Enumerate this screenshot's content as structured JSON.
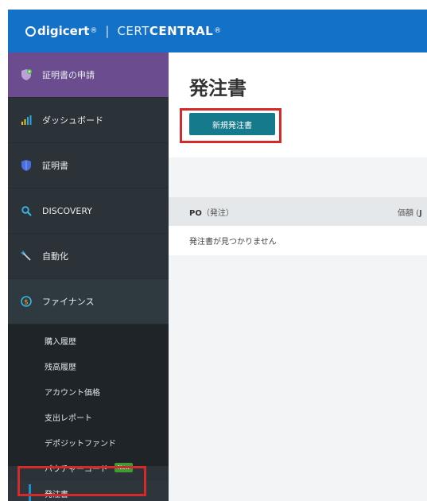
{
  "header": {
    "logo_brand": "digicert",
    "logo_reg": "®",
    "logo_sep": "|",
    "logo_product_1": "CERT",
    "logo_product_2": "CENTRAL",
    "logo_product_reg": "®"
  },
  "sidebar": {
    "items": [
      {
        "label": "証明書の申請",
        "icon": "shield-plus-icon"
      },
      {
        "label": "ダッシュボード",
        "icon": "bar-chart-icon"
      },
      {
        "label": "証明書",
        "icon": "shield-icon"
      },
      {
        "label": "DISCOVERY",
        "icon": "search-icon"
      },
      {
        "label": "自動化",
        "icon": "wand-icon"
      },
      {
        "label": "ファイナンス",
        "icon": "dollar-circle-icon"
      }
    ],
    "finance_subitems": [
      {
        "label": "購入履歴"
      },
      {
        "label": "残高履歴"
      },
      {
        "label": "アカウント価格"
      },
      {
        "label": "支出レポート"
      },
      {
        "label": "デポジットファンド"
      },
      {
        "label": "バウチャーコード",
        "badge": "New"
      },
      {
        "label": "発注書"
      }
    ]
  },
  "main": {
    "title": "発注書",
    "new_button": "新規発注書",
    "table": {
      "col_po_bold": "PO",
      "col_po_rest": "（発注）",
      "col_price_prefix": "価額 (",
      "col_price_bold": "J",
      "empty_message": "発注書が見つかりません"
    }
  },
  "colors": {
    "header_bg": "#1471c8",
    "sidebar_bg": "#2c3338",
    "active_top_bg": "#6a4c8f",
    "button_bg": "#147a8c",
    "highlight": "#d42a2a",
    "new_badge": "#3f9b35"
  }
}
